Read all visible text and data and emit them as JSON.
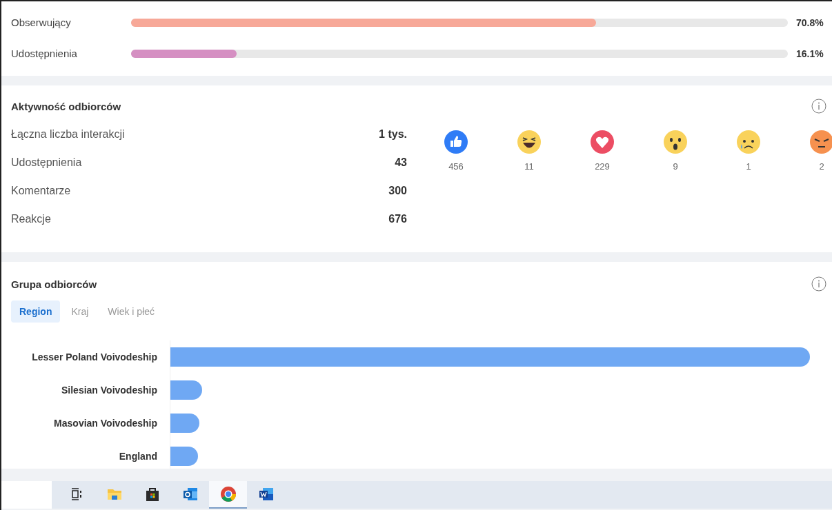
{
  "distribution": [
    {
      "label": "Obserwujący",
      "level": 0.708,
      "value": "70.8%",
      "color": "#f7a898"
    },
    {
      "label": "Udostępnienia",
      "level": 0.161,
      "value": "16.1%",
      "color": "#d58fc2"
    }
  ],
  "activity": {
    "title": "Aktywność odbiorców",
    "stats": [
      {
        "label": "Łączna liczba interakcji",
        "value": "1 tys."
      },
      {
        "label": "Udostępnienia",
        "value": "43"
      },
      {
        "label": "Komentarze",
        "value": "300"
      },
      {
        "label": "Reakcje",
        "value": "676"
      }
    ],
    "reactions": [
      {
        "kind": "like",
        "count": "456"
      },
      {
        "kind": "haha",
        "count": "11"
      },
      {
        "kind": "love",
        "count": "229"
      },
      {
        "kind": "wow",
        "count": "9"
      },
      {
        "kind": "sad",
        "count": "1"
      },
      {
        "kind": "angry",
        "count": "2"
      }
    ]
  },
  "audience": {
    "title": "Grupa odbiorców",
    "tabs": [
      {
        "label": "Region",
        "selected": true
      },
      {
        "label": "Kraj",
        "selected": false
      },
      {
        "label": "Wiek i płeć",
        "selected": false
      }
    ],
    "regions": [
      {
        "label": "Lesser Poland Voivodeship",
        "level": 1.0
      },
      {
        "label": "Silesian Voivodeship",
        "level": 0.05
      },
      {
        "label": "Masovian Voivodeship",
        "level": 0.045
      },
      {
        "label": "England",
        "level": 0.043
      }
    ]
  },
  "taskbar": {
    "apps": [
      {
        "kind": "taskview"
      },
      {
        "kind": "folder"
      },
      {
        "kind": "store"
      },
      {
        "kind": "mail"
      },
      {
        "kind": "browser",
        "selected": true
      },
      {
        "kind": "document"
      }
    ]
  }
}
